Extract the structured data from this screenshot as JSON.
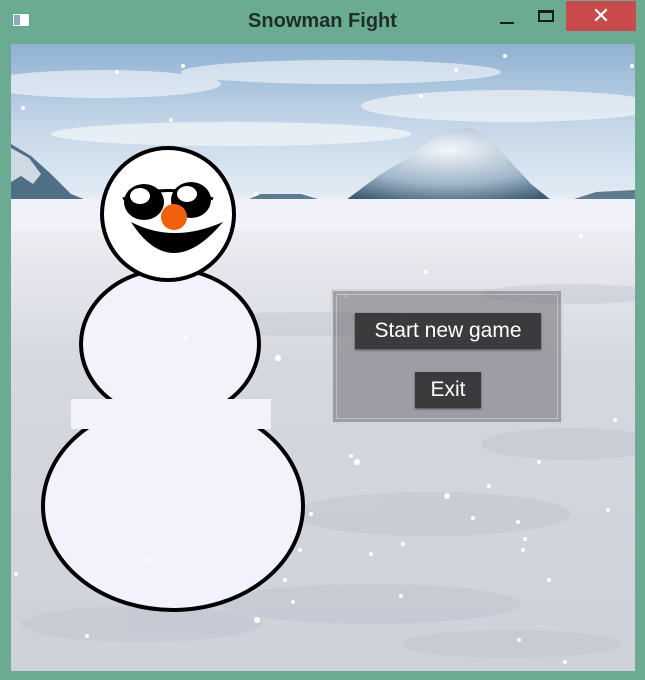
{
  "window": {
    "title": "Snowman Fight",
    "close_glyph": "✕",
    "icons": [
      "app-icon",
      "minimize-icon",
      "maximize-icon",
      "close-icon"
    ]
  },
  "menu": {
    "start_label": "Start new game",
    "exit_label": "Exit"
  },
  "colors": {
    "sky": "#b9cfe4",
    "snow_ground": "#dfe2ea",
    "snowman_body": "#f2f2fd",
    "nose": "#f2600c",
    "menu_button": "#3b3b3d",
    "close_button": "#c94b4b"
  }
}
